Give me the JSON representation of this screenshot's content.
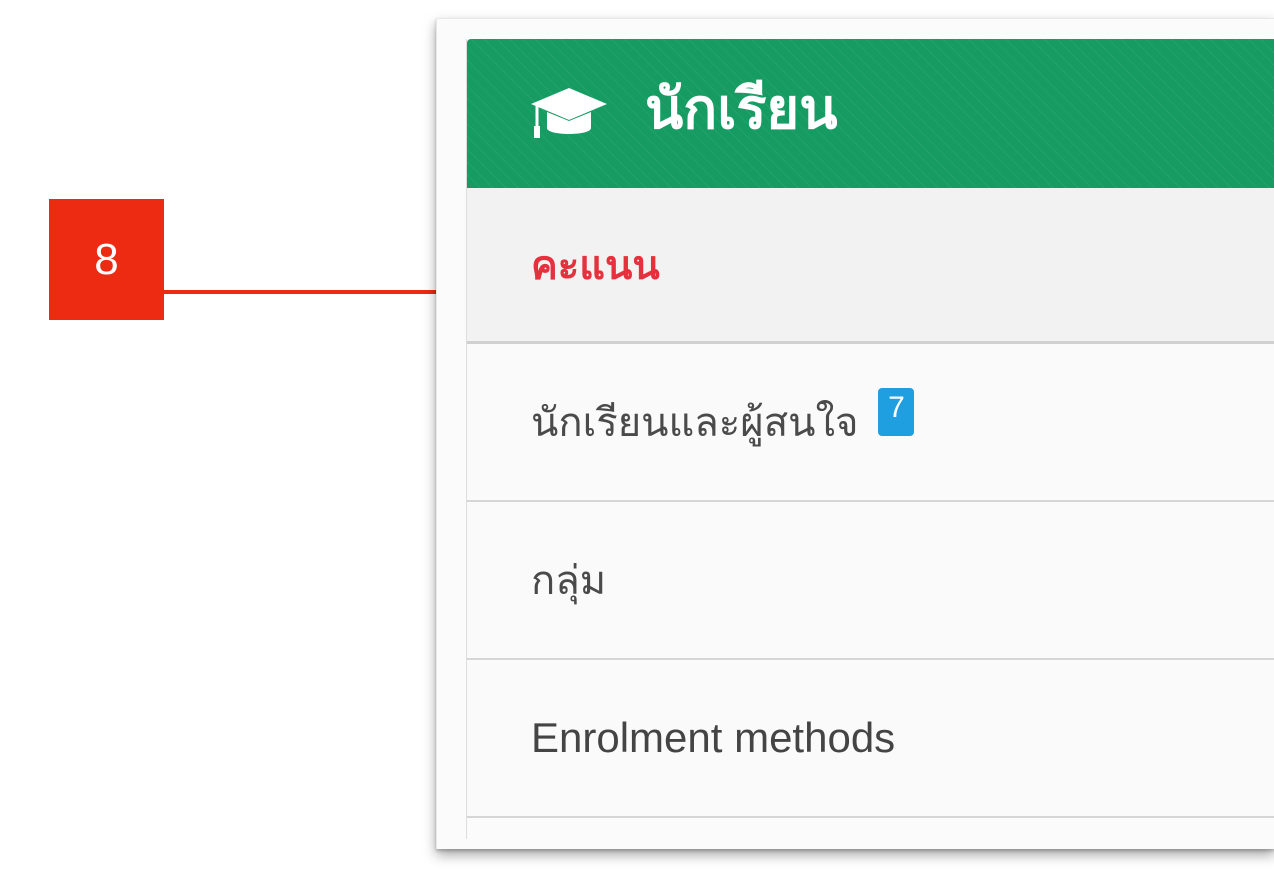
{
  "annotation": {
    "number": "8",
    "color": "#ed2a12"
  },
  "panel": {
    "header_icon": "graduation-cap-icon",
    "title": "นักเรียน",
    "header_color": "#169c63"
  },
  "menu": {
    "items": [
      {
        "label": "คะแนน",
        "active": true,
        "color": "#e5313d"
      },
      {
        "label": "นักเรียนและผู้สนใจ",
        "badge": "7",
        "badge_color": "#1f9ee0"
      },
      {
        "label": "กลุ่ม"
      },
      {
        "label": "Enrolment methods"
      }
    ]
  }
}
